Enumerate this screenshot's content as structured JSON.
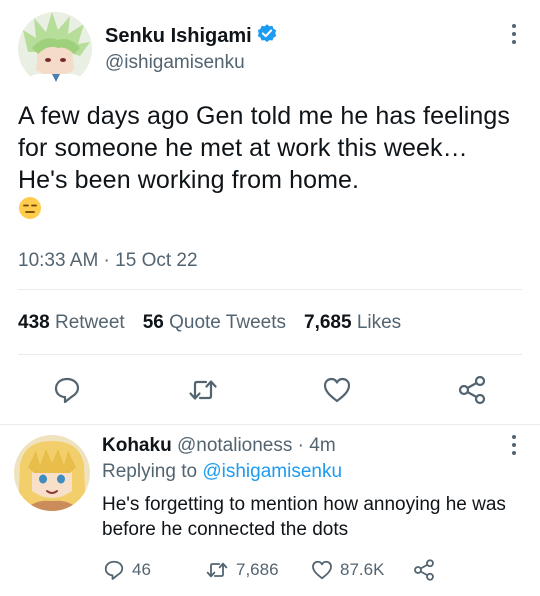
{
  "tweet": {
    "display_name": "Senku Ishigami",
    "handle": "@ishigamisenku",
    "text": "A few days ago Gen told me he has feelings for someone he met at work this week… He's been working from home.",
    "emoji": "😑",
    "time": "10:33 AM",
    "separator": " · ",
    "date": "15 Oct 22",
    "stats": {
      "retweets": "438",
      "retweets_label": "Retweet",
      "quotes": "56",
      "quotes_label": "Quote Tweets",
      "likes": "7,685",
      "likes_label": "Likes"
    },
    "icons": [
      "reply-icon",
      "retweet-icon",
      "like-icon",
      "share-icon"
    ],
    "verified_color": "#1d9bf0"
  },
  "reply": {
    "display_name": "Kohaku",
    "handle": "@notalioness",
    "separator": " · ",
    "time": "4m",
    "replying_prefix": "Replying to ",
    "replying_to": "@ishigamisenku",
    "text": "He's forgetting to mention how annoying he was before he connected the dots",
    "counts": {
      "replies": "46",
      "retweets": "7,686",
      "likes": "87.6K"
    }
  },
  "colors": {
    "text_primary": "#0f1419",
    "text_secondary": "#536471",
    "accent": "#1d9bf0",
    "divider": "#e6ecf0"
  }
}
